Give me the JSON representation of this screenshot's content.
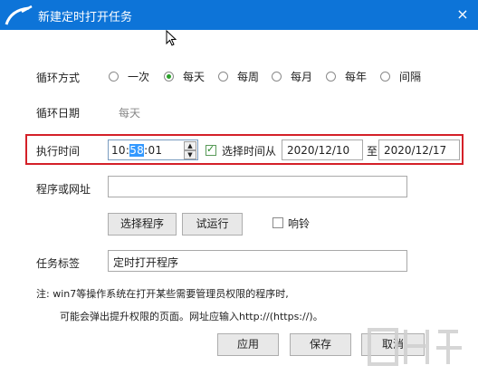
{
  "window": {
    "title": "新建定时打开任务",
    "close": "×"
  },
  "loop": {
    "label": "循环方式",
    "options": [
      {
        "label": "一次",
        "selected": false
      },
      {
        "label": "每天",
        "selected": true
      },
      {
        "label": "每周",
        "selected": false
      },
      {
        "label": "每月",
        "selected": false
      },
      {
        "label": "每年",
        "selected": false
      },
      {
        "label": "间隔",
        "selected": false
      }
    ]
  },
  "loop_date": {
    "label": "循环日期",
    "value": "每天"
  },
  "exec_time": {
    "label": "执行时间",
    "hour": "10",
    "sep1": ":",
    "minute": "58",
    "sep2": ":",
    "second": "01",
    "range_checkbox_label": "选择时间从",
    "range_checked": true,
    "from": "2020/12/10",
    "to_label": "至",
    "to": "2020/12/17"
  },
  "program": {
    "label": "程序或网址",
    "value": ""
  },
  "actions": {
    "select_program": "选择程序",
    "test_run": "试运行",
    "ring_label": "响铃",
    "ring_checked": false
  },
  "task_tag": {
    "label": "任务标签",
    "value": "定时打开程序"
  },
  "notes": {
    "line1": "注: win7等操作系统在打开某些需要管理员权限的程序时,",
    "line2": "可能会弹出提升权限的页面。网址应输入http://(https://)。"
  },
  "footer": {
    "apply": "应用",
    "save": "保存",
    "cancel": "取消"
  },
  "colors": {
    "titlebar": "#0d74d8",
    "highlight_border": "#d42028",
    "radio_selected": "#2aa02a"
  }
}
